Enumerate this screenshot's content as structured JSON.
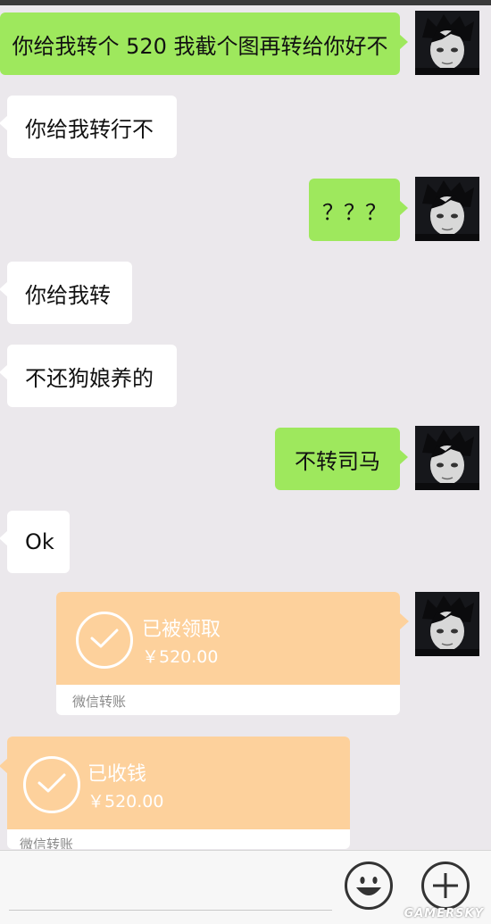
{
  "messages": {
    "m1": "你给我转个 520 我截个图再转给你好不",
    "m2": "你给我转行不",
    "m3": "？？？",
    "m4": "你给我转",
    "m5": "不还狗娘养的",
    "m6": "不转司马",
    "m7": "Ok"
  },
  "transfers": {
    "t1": {
      "status": "已被领取",
      "amount": "￥520.00",
      "footer": "微信转账"
    },
    "t2": {
      "status": "已收钱",
      "amount": "￥520.00",
      "footer": "微信转账"
    }
  },
  "watermark": "GAMERSKY",
  "icons": [
    "avatar-icon",
    "check-icon",
    "emoji-icon",
    "plus-icon"
  ],
  "colors": {
    "outgoing": "#9ee85d",
    "incoming": "#ffffff",
    "transfer": "#fdd19c",
    "background": "#ebe8ec"
  }
}
